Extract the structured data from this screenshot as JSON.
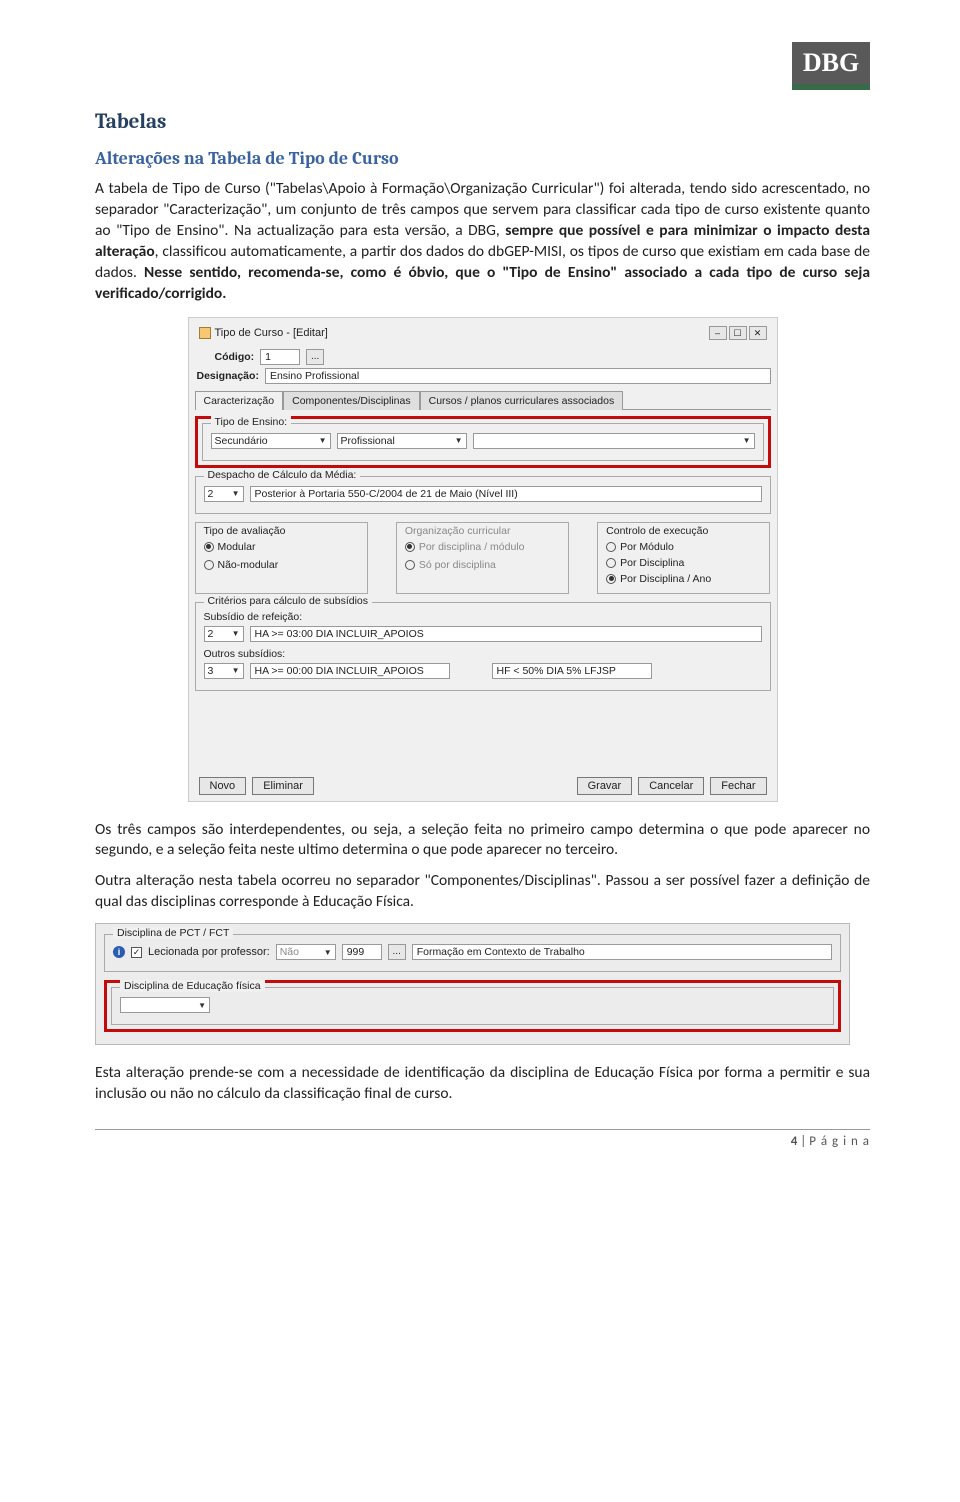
{
  "logo": "DBG",
  "heading1": "Tabelas",
  "heading2": "Alterações na Tabela de Tipo de Curso",
  "para1_a": "A tabela de Tipo de Curso (\"Tabelas\\Apoio à Formação\\Organização Curricular\") foi alterada, tendo sido acrescentado, no separador \"Caracterização\", um conjunto de três campos que servem para classificar cada tipo de curso existente quanto ao \"Tipo de Ensino\". Na actualização para esta versão, a DBG, ",
  "para1_bold": "sempre que possível e para minimizar o impacto desta alteração",
  "para1_b": ", classificou automaticamente, a partir dos dados do dbGEP-MISI, os tipos de curso que existiam em cada base de dados. ",
  "para1_bold2": "Nesse sentido, recomenda-se, como é óbvio, que o \"Tipo de Ensino\" associado a cada tipo de curso seja verificado/corrigido.",
  "dialog1": {
    "title": "Tipo de Curso - [Editar]",
    "codigo_label": "Código:",
    "codigo_value": "1",
    "design_label": "Designação:",
    "design_value": "Ensino Profissional",
    "tabs": [
      "Caracterização",
      "Componentes/Disciplinas",
      "Cursos / planos curriculares associados"
    ],
    "tipo_ensino_label": "Tipo de Ensino:",
    "tipo_sel1": "Secundário",
    "tipo_sel2": "Profissional",
    "despacho_group": "Despacho de Cálculo da Média:",
    "despacho_num": "2",
    "despacho_text": "Posterior à Portaria 550-C/2004 de 21 de Maio (Nível III)",
    "col1_title": "Tipo de avaliação",
    "col1_r1": "Modular",
    "col1_r2": "Não-modular",
    "col2_title": "Organização curricular",
    "col2_r1": "Por disciplina / módulo",
    "col2_r2": "Só por disciplina",
    "col3_title": "Controlo de execução",
    "col3_r1": "Por Módulo",
    "col3_r2": "Por Disciplina",
    "col3_r3": "Por Disciplina / Ano",
    "crit_group": "Critérios para cálculo de subsídios",
    "sub_ref_label": "Subsídio de refeição:",
    "sub_ref_num": "2",
    "sub_ref_text": "HA >= 03:00 DIA INCLUIR_APOIOS",
    "outros_label": "Outros subsídios:",
    "outros_num": "3",
    "outros_text": "HA >= 00:00 DIA INCLUIR_APOIOS",
    "outros_text2": "HF < 50% DIA 5% LFJSP",
    "buttons": {
      "novo": "Novo",
      "eliminar": "Eliminar",
      "gravar": "Gravar",
      "cancelar": "Cancelar",
      "fechar": "Fechar"
    }
  },
  "para2": "Os três campos são interdependentes, ou seja, a seleção feita no primeiro campo determina o que pode aparecer no segundo, e a seleção feita neste ultimo determina o que pode aparecer no terceiro.",
  "para3": "Outra alteração nesta tabela ocorreu no separador \"Componentes/Disciplinas\". Passou a ser possível fazer a definição de qual das disciplinas corresponde à Educação Física.",
  "dialog2": {
    "group1": "Disciplina de PCT / FCT",
    "lec_label": "Lecionada por professor:",
    "lec_val": "Não",
    "code": "999",
    "desc": "Formação em Contexto de Trabalho",
    "group2": "Disciplina de Educação física"
  },
  "para4": "Esta alteração prende-se com a necessidade de identificação da disciplina de Educação Física por forma a permitir e sua inclusão ou não no cálculo da classificação final de curso.",
  "footer_num": "4",
  "footer_text": "P á g i n a"
}
